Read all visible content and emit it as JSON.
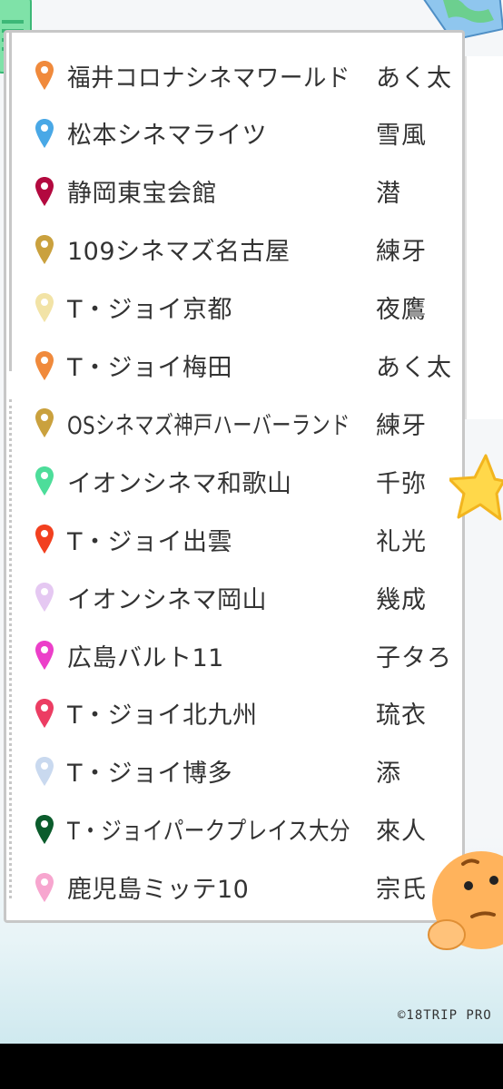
{
  "rows": [
    {
      "theater": "福井コロナシネマワールド",
      "name": "あく太",
      "pin_color": "#f08a3c"
    },
    {
      "theater": "松本シネマライツ",
      "name": "雪風",
      "pin_color": "#49a8e6"
    },
    {
      "theater": "静岡東宝会館",
      "name": "潜",
      "pin_color": "#b3093f"
    },
    {
      "theater": "109シネマズ名古屋",
      "name": "練牙",
      "pin_color": "#caa13e"
    },
    {
      "theater": "T・ジョイ京都",
      "name": "夜鷹",
      "pin_color": "#f2e3a6"
    },
    {
      "theater": "T・ジョイ梅田",
      "name": "あく太",
      "pin_color": "#f08a3c"
    },
    {
      "theater": "OSシネマズ神戸ハーバーランド",
      "name": "練牙",
      "pin_color": "#caa13e"
    },
    {
      "theater": "イオンシネマ和歌山",
      "name": "千弥",
      "pin_color": "#4ddd9a"
    },
    {
      "theater": "T・ジョイ出雲",
      "name": "礼光",
      "pin_color": "#f2401f"
    },
    {
      "theater": "イオンシネマ岡山",
      "name": "幾成",
      "pin_color": "#e5c8f2"
    },
    {
      "theater": "広島バルト11",
      "name": "子タろ",
      "pin_color": "#ec3fc9"
    },
    {
      "theater": "T・ジョイ北九州",
      "name": "琉衣",
      "pin_color": "#ec3d63"
    },
    {
      "theater": "T・ジョイ博多",
      "name": "添",
      "pin_color": "#c9d9ef"
    },
    {
      "theater": "T・ジョイパークプレイス大分",
      "name": "來人",
      "pin_color": "#0b5c2c"
    },
    {
      "theater": "鹿児島ミッテ10",
      "name": "宗氏",
      "pin_color": "#f7a6cf"
    }
  ],
  "copyright": "©18TRIP PRO",
  "icons": {
    "row_marker": "map-pin-icon",
    "decorations": [
      "ticket-icon",
      "map-icon",
      "star-icon",
      "thinking-face-icon"
    ]
  }
}
